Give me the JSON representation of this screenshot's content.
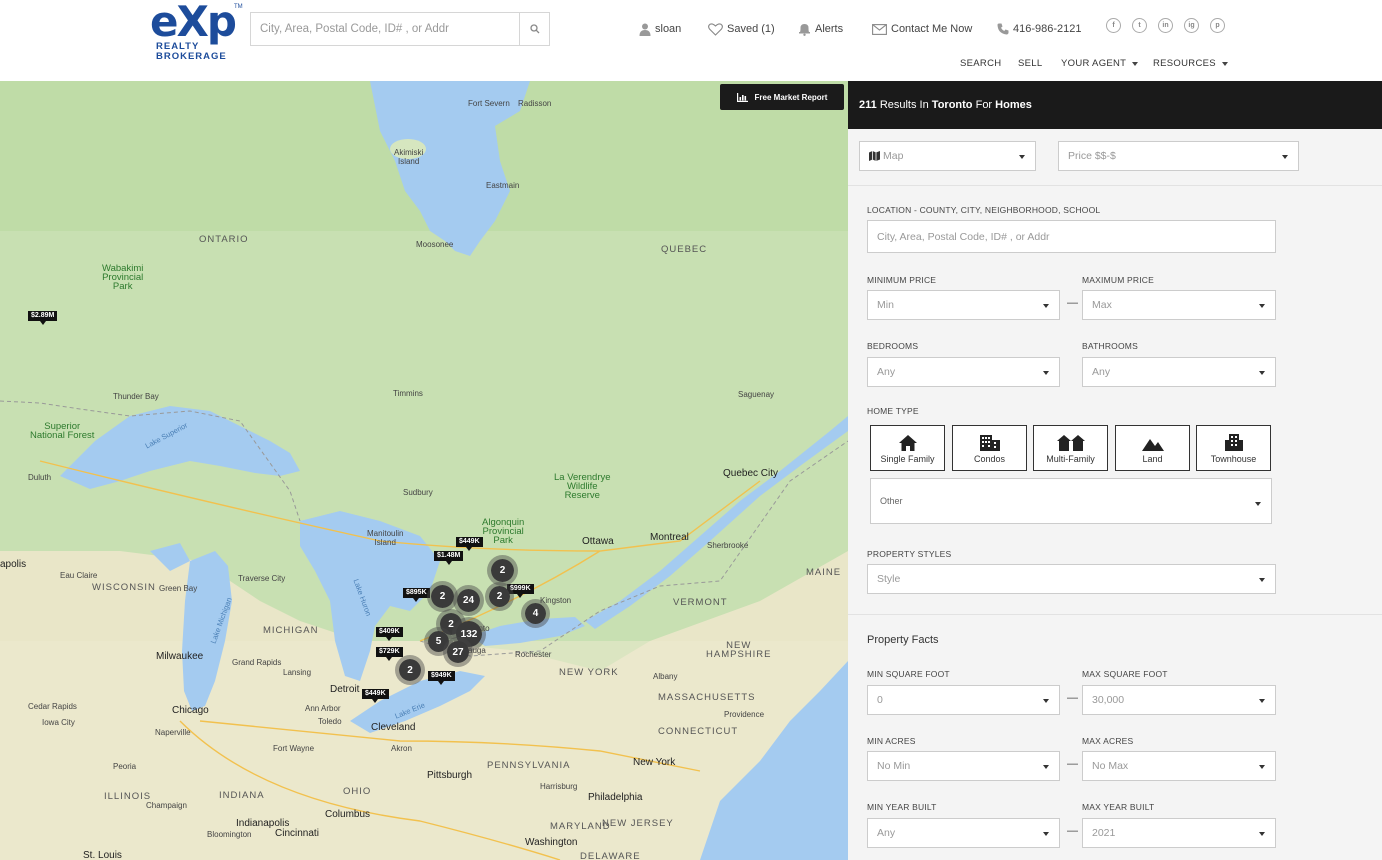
{
  "header": {
    "logo": {
      "wordmark": "eXp",
      "line1": "REALTY",
      "line2": "BROKERAGE",
      "tm": "TM"
    },
    "search_placeholder": "City, Area, Postal Code, ID# , or Addr",
    "user": "sloan",
    "saved": "Saved (1)",
    "alerts": "Alerts",
    "contact": "Contact Me Now",
    "phone": "416-986-2121",
    "social": [
      "f",
      "t",
      "in",
      "ig",
      "p"
    ],
    "nav": {
      "search": "SEARCH",
      "sell": "SELL",
      "agent": "YOUR AGENT",
      "resources": "RESOURCES"
    }
  },
  "map": {
    "report_button": "Free Market Report",
    "labels": {
      "ontario": "ONTARIO",
      "quebec": "QUEBEC",
      "wisconsin": "WISCONSIN",
      "michigan": "MICHIGAN",
      "new_york": "NEW YORK",
      "vermont": "VERMONT",
      "new_hampshire": "NEW\nHAMPSHIRE",
      "maine": "MAINE",
      "massachusetts": "MASSACHUSETTS",
      "connecticut": "CONNECTICUT",
      "pennsylvania": "PENNSYLVANIA",
      "ohio": "OHIO",
      "indiana": "INDIANA",
      "illinois": "ILLINOIS",
      "maryland": "MARYLAND",
      "new_jersey": "NEW JERSEY",
      "delaware": "DELAWARE",
      "wabakimi": "Wabakimi\nProvincial\nPark",
      "superior_forest": "Superior\nNational Forest",
      "algonquin": "Algonquin\nProvincial\nPark",
      "verendrye": "La Verendrye\nWildlife\nReserve",
      "akimiski": "Akimiski\nIsland",
      "fort_severn": "Fort Severn",
      "radisson": "Radisson",
      "eastmain": "Eastmain",
      "moosonee": "Moosonee",
      "thunder_bay": "Thunder Bay",
      "timmins": "Timmins",
      "saguenay": "Saguenay",
      "quebec_city": "Quebec City",
      "duluth": "Duluth",
      "sudbury": "Sudbury",
      "manitoulin": "Manitoulin\nIsland",
      "ottawa": "Ottawa",
      "montreal": "Montreal",
      "sherbrooke": "Sherbrooke",
      "kingston": "Kingston",
      "eau_claire": "Eau Claire",
      "green_bay": "Green Bay",
      "traverse": "Traverse City",
      "milwaukee": "Milwaukee",
      "grand_rapids": "Grand Rapids",
      "lansing": "Lansing",
      "detroit": "Detroit",
      "ann_arbor": "Ann Arbor",
      "toledo": "Toledo",
      "cleveland": "Cleveland",
      "akron": "Akron",
      "chicago": "Chicago",
      "naperville": "Naperville",
      "cedar_rapids": "Cedar Rapids",
      "iowa_city": "Iowa City",
      "peoria": "Peoria",
      "champaign": "Champaign",
      "fort_wayne": "Fort Wayne",
      "indianapolis": "Indianapolis",
      "bloomington": "Bloomington",
      "cincinnati": "Cincinnati",
      "columbus": "Columbus",
      "pittsburgh": "Pittsburgh",
      "harrisburg": "Harrisburg",
      "philadelphia": "Philadelphia",
      "washington": "Washington",
      "new_york_city": "New York",
      "albany": "Albany",
      "rochester": "Rochester",
      "providence": "Providence",
      "st_louis": "St. Louis",
      "minneapolis": "apolis",
      "oronto": "onto",
      "auga": "auga",
      "lake_superior": "Lake Superior",
      "lake_michigan": "Lake Michigan",
      "lake_huron": "Lake Huron",
      "lake_erie": "Lake Erie"
    },
    "pins": [
      "$2.89M",
      "$449K",
      "$1.48M",
      "$895K",
      "$999K",
      "$409K",
      "$729K",
      "$449K",
      "$949K"
    ],
    "clusters": [
      "2",
      "2",
      "24",
      "2",
      "4",
      "2",
      "132",
      "5",
      "27",
      "2"
    ]
  },
  "panel": {
    "results": {
      "count": "211",
      "mid1": "Results In",
      "city": "Toronto",
      "mid2": "For",
      "type": "Homes"
    },
    "view_select": "Map",
    "price_select": "Price $$-$",
    "location_label": "LOCATION - COUNTY, CITY, NEIGHBORHOOD, SCHOOL",
    "location_placeholder": "City, Area, Postal Code, ID# , or Addr",
    "min_price_label": "MINIMUM PRICE",
    "max_price_label": "MAXIMUM PRICE",
    "min_price": "Min",
    "max_price": "Max",
    "bedrooms_label": "BEDROOMS",
    "bathrooms_label": "BATHROOMS",
    "bedrooms": "Any",
    "bathrooms": "Any",
    "home_type_label": "HOME TYPE",
    "home_types": [
      "Single Family",
      "Condos",
      "Multi-Family",
      "Land",
      "Townhouse"
    ],
    "other_select": "Other",
    "styles_label": "PROPERTY STYLES",
    "style_select": "Style",
    "facts_title": "Property Facts",
    "min_sqft_label": "MIN SQUARE FOOT",
    "max_sqft_label": "MAX SQUARE FOOT",
    "min_sqft": "0",
    "max_sqft": "30,000",
    "min_acres_label": "MIN ACRES",
    "max_acres_label": "MAX ACRES",
    "min_acres": "No Min",
    "max_acres": "No Max",
    "min_year_label": "MIN YEAR BUILT",
    "max_year_label": "MAX YEAR BUILT",
    "min_year": "Any",
    "max_year": "2021",
    "dash": "—"
  }
}
